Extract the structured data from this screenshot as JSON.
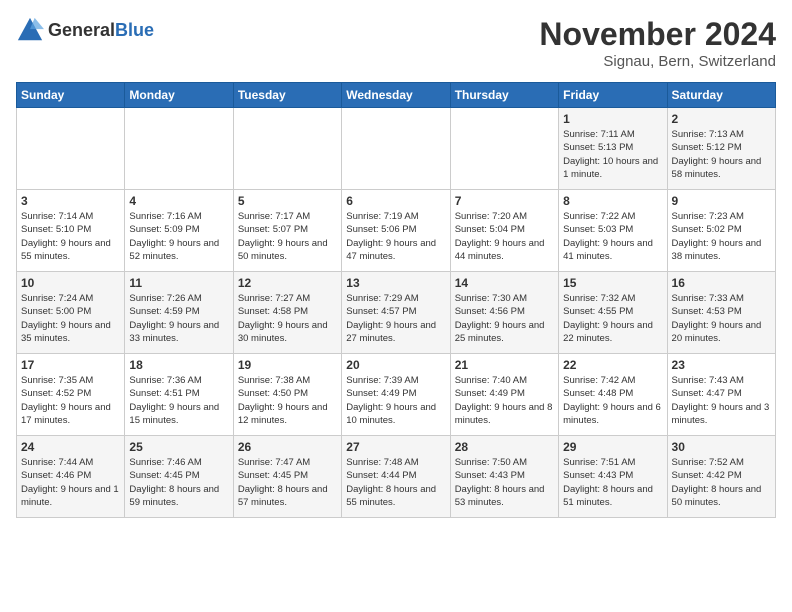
{
  "logo": {
    "text_general": "General",
    "text_blue": "Blue"
  },
  "title": "November 2024",
  "subtitle": "Signau, Bern, Switzerland",
  "weekdays": [
    "Sunday",
    "Monday",
    "Tuesday",
    "Wednesday",
    "Thursday",
    "Friday",
    "Saturday"
  ],
  "rows": [
    [
      {
        "day": "",
        "info": ""
      },
      {
        "day": "",
        "info": ""
      },
      {
        "day": "",
        "info": ""
      },
      {
        "day": "",
        "info": ""
      },
      {
        "day": "",
        "info": ""
      },
      {
        "day": "1",
        "info": "Sunrise: 7:11 AM\nSunset: 5:13 PM\nDaylight: 10 hours and 1 minute."
      },
      {
        "day": "2",
        "info": "Sunrise: 7:13 AM\nSunset: 5:12 PM\nDaylight: 9 hours and 58 minutes."
      }
    ],
    [
      {
        "day": "3",
        "info": "Sunrise: 7:14 AM\nSunset: 5:10 PM\nDaylight: 9 hours and 55 minutes."
      },
      {
        "day": "4",
        "info": "Sunrise: 7:16 AM\nSunset: 5:09 PM\nDaylight: 9 hours and 52 minutes."
      },
      {
        "day": "5",
        "info": "Sunrise: 7:17 AM\nSunset: 5:07 PM\nDaylight: 9 hours and 50 minutes."
      },
      {
        "day": "6",
        "info": "Sunrise: 7:19 AM\nSunset: 5:06 PM\nDaylight: 9 hours and 47 minutes."
      },
      {
        "day": "7",
        "info": "Sunrise: 7:20 AM\nSunset: 5:04 PM\nDaylight: 9 hours and 44 minutes."
      },
      {
        "day": "8",
        "info": "Sunrise: 7:22 AM\nSunset: 5:03 PM\nDaylight: 9 hours and 41 minutes."
      },
      {
        "day": "9",
        "info": "Sunrise: 7:23 AM\nSunset: 5:02 PM\nDaylight: 9 hours and 38 minutes."
      }
    ],
    [
      {
        "day": "10",
        "info": "Sunrise: 7:24 AM\nSunset: 5:00 PM\nDaylight: 9 hours and 35 minutes."
      },
      {
        "day": "11",
        "info": "Sunrise: 7:26 AM\nSunset: 4:59 PM\nDaylight: 9 hours and 33 minutes."
      },
      {
        "day": "12",
        "info": "Sunrise: 7:27 AM\nSunset: 4:58 PM\nDaylight: 9 hours and 30 minutes."
      },
      {
        "day": "13",
        "info": "Sunrise: 7:29 AM\nSunset: 4:57 PM\nDaylight: 9 hours and 27 minutes."
      },
      {
        "day": "14",
        "info": "Sunrise: 7:30 AM\nSunset: 4:56 PM\nDaylight: 9 hours and 25 minutes."
      },
      {
        "day": "15",
        "info": "Sunrise: 7:32 AM\nSunset: 4:55 PM\nDaylight: 9 hours and 22 minutes."
      },
      {
        "day": "16",
        "info": "Sunrise: 7:33 AM\nSunset: 4:53 PM\nDaylight: 9 hours and 20 minutes."
      }
    ],
    [
      {
        "day": "17",
        "info": "Sunrise: 7:35 AM\nSunset: 4:52 PM\nDaylight: 9 hours and 17 minutes."
      },
      {
        "day": "18",
        "info": "Sunrise: 7:36 AM\nSunset: 4:51 PM\nDaylight: 9 hours and 15 minutes."
      },
      {
        "day": "19",
        "info": "Sunrise: 7:38 AM\nSunset: 4:50 PM\nDaylight: 9 hours and 12 minutes."
      },
      {
        "day": "20",
        "info": "Sunrise: 7:39 AM\nSunset: 4:49 PM\nDaylight: 9 hours and 10 minutes."
      },
      {
        "day": "21",
        "info": "Sunrise: 7:40 AM\nSunset: 4:49 PM\nDaylight: 9 hours and 8 minutes."
      },
      {
        "day": "22",
        "info": "Sunrise: 7:42 AM\nSunset: 4:48 PM\nDaylight: 9 hours and 6 minutes."
      },
      {
        "day": "23",
        "info": "Sunrise: 7:43 AM\nSunset: 4:47 PM\nDaylight: 9 hours and 3 minutes."
      }
    ],
    [
      {
        "day": "24",
        "info": "Sunrise: 7:44 AM\nSunset: 4:46 PM\nDaylight: 9 hours and 1 minute."
      },
      {
        "day": "25",
        "info": "Sunrise: 7:46 AM\nSunset: 4:45 PM\nDaylight: 8 hours and 59 minutes."
      },
      {
        "day": "26",
        "info": "Sunrise: 7:47 AM\nSunset: 4:45 PM\nDaylight: 8 hours and 57 minutes."
      },
      {
        "day": "27",
        "info": "Sunrise: 7:48 AM\nSunset: 4:44 PM\nDaylight: 8 hours and 55 minutes."
      },
      {
        "day": "28",
        "info": "Sunrise: 7:50 AM\nSunset: 4:43 PM\nDaylight: 8 hours and 53 minutes."
      },
      {
        "day": "29",
        "info": "Sunrise: 7:51 AM\nSunset: 4:43 PM\nDaylight: 8 hours and 51 minutes."
      },
      {
        "day": "30",
        "info": "Sunrise: 7:52 AM\nSunset: 4:42 PM\nDaylight: 8 hours and 50 minutes."
      }
    ]
  ]
}
